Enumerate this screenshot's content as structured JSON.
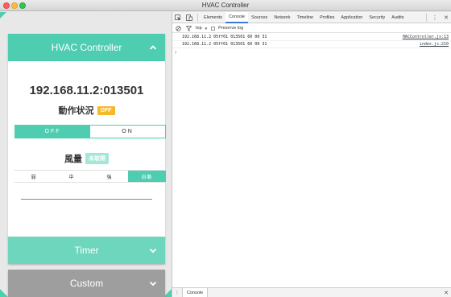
{
  "window": {
    "title": "HVAC Controller"
  },
  "app": {
    "hvac_panel": {
      "title": "HVAC Controller",
      "address": "192.168.11.2:013501",
      "status_label": "動作状況",
      "status_badge": "OFF",
      "power_off": "OFF",
      "power_on": "ON",
      "fan_label": "風量",
      "fan_badge": "未取得",
      "fan_options": [
        "弱",
        "中",
        "強",
        "自動"
      ]
    },
    "timer_panel": {
      "title": "Timer"
    },
    "custom_panel": {
      "title": "Custom"
    },
    "colors": {
      "accent": "#4ecdb0",
      "badge_off": "#f5b82a",
      "custom": "#9e9e9e"
    }
  },
  "devtools": {
    "tabs": [
      "Elements",
      "Console",
      "Sources",
      "Network",
      "Timeline",
      "Profiles",
      "Application",
      "Security",
      "Audits"
    ],
    "active_tab": "Console",
    "toolbar": {
      "context": "top",
      "preserve_log": "Preserve log"
    },
    "logs": [
      {
        "message": "192.168.11.2 05ff01 013501 60 00 31",
        "source": "HACController.js:13"
      },
      {
        "message": "192.168.11.2 05ff01 013501 60 00 31",
        "source": "index.js:210"
      }
    ],
    "drawer": {
      "tab": "Console"
    }
  }
}
